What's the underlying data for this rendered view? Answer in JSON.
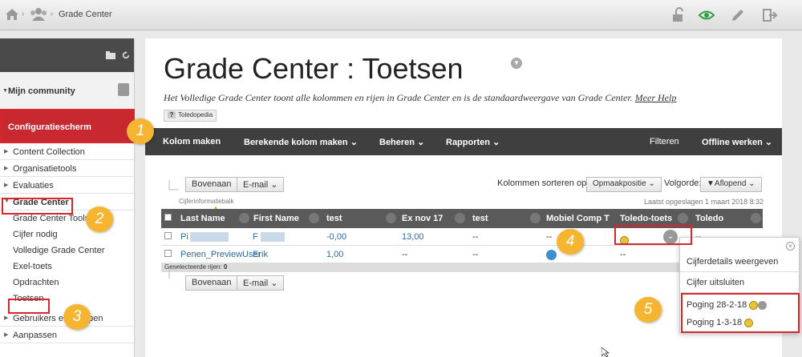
{
  "breadcrumb": {
    "separator": "›",
    "current": "Grade Center"
  },
  "sidebar": {
    "my_community": "Mijn community",
    "control_panel": "Configuratiescherm",
    "items": [
      "Content Collection",
      "Organisatietools",
      "Evaluaties",
      "Grade Center"
    ],
    "grade_center_sub": [
      "Grade Center Tools",
      "Cijfer nodig",
      "Volledige Grade Center",
      "Exel-toets",
      "Opdrachten",
      "Toetsen"
    ],
    "items_after": [
      "Gebruikers en groepen",
      "Aanpassen"
    ]
  },
  "page": {
    "title": "Grade Center : Toetsen",
    "description": "Het Volledige Grade Center toont alle kolommen en rijen in Grade Center en is de standaardweergave van Grade Center.",
    "help_link": "Meer Help",
    "toledopedia": "Toledopedia",
    "toledopedia_icon": "?"
  },
  "action_bar": {
    "create_column": "Kolom maken",
    "calculated_column": "Berekende kolom maken",
    "manage": "Beheren",
    "reports": "Rapporten",
    "filter": "Filteren",
    "work_offline": "Offline werken"
  },
  "toolbar": {
    "top_button": "Bovenaan",
    "email_button": "E-mail",
    "sort_label": "Kolommen sorteren op:",
    "sort_value": "Opmaakpositie",
    "order_label": "Volgorde:",
    "order_value": "▼Aflopend",
    "info_bar": "Cijferinformatiebalk",
    "last_saved": "Laatst opgeslagen 1 maart 2018 8:32"
  },
  "grid": {
    "columns": [
      "Last Name",
      "First Name",
      "test",
      "Ex nov 17",
      "test",
      "Mobiel Comp T",
      "Toledo-toets",
      "Toledo"
    ],
    "rows": [
      {
        "last": "Pi",
        "first": "F",
        "c1": "-0,00",
        "c2": "13,00",
        "c3": "--",
        "c4": "--",
        "c5": "",
        "c6": "--"
      },
      {
        "last": "Penen_PreviewUser",
        "first": "Erik",
        "c1": "1,00",
        "c2": "--",
        "c3": "--",
        "c4": "",
        "c5": "--",
        "c6": ""
      }
    ],
    "selected_rows_label": "Geselecteerde rijen:",
    "selected_rows_count": "0"
  },
  "popup": {
    "view_details": "Cijferdetails weergeven",
    "clear_grade": "Cijfer uitsluiten",
    "attempt1": "Poging 28-2-18",
    "attempt2": "Poging 1-3-18"
  },
  "callouts": [
    "1",
    "2",
    "3",
    "4",
    "5"
  ],
  "colors": {
    "control_panel": "#c8282f",
    "callout": "#f5b531",
    "highlight": "#d7262d",
    "action_bar": "#3f3f3f"
  }
}
